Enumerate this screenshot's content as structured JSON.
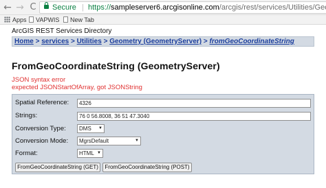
{
  "browser": {
    "nav": {
      "back": "←",
      "forward": "→",
      "reload": "C"
    },
    "secure_label": "Secure",
    "separator": "|",
    "url_scheme": "https://",
    "url_host": "sampleserver6.arcgisonline.com",
    "url_path": "/arcgis/rest/services/Utilities/Geometry/GeometryServer"
  },
  "bookmarks": [
    {
      "label": "Apps"
    },
    {
      "label": "VAPWIS"
    },
    {
      "label": "New Tab"
    }
  ],
  "page": {
    "header": "ArcGIS REST Services Directory",
    "breadcrumb": {
      "items": [
        "Home",
        "services",
        "Utilities",
        "Geometry (GeometryServer)",
        "fromGeoCoordinateString"
      ],
      "separator": ">"
    },
    "title": "FromGeoCoordinateString (GeometryServer)",
    "errors": [
      "JSON syntax error",
      "expected JSONStartOfArray, got JSONString"
    ]
  },
  "form": {
    "spatial_reference": {
      "label": "Spatial Reference:",
      "value": "4326"
    },
    "strings": {
      "label": "Strings:",
      "value": "76 0 56.8008, 36 51 47.3040"
    },
    "conversion_type": {
      "label": "Conversion Type:",
      "value": "DMS"
    },
    "conversion_mode": {
      "label": "Conversion Mode:",
      "value": "MgrsDefault"
    },
    "format": {
      "label": "Format:",
      "value": "HTML"
    },
    "buttons": {
      "get": "FromGeoCoordinateString (GET)",
      "post": "FromGeoCoordinateString (POST)"
    }
  },
  "colors": {
    "secure_green": "#0b8043",
    "link_blue": "#1a3d9c",
    "error_red": "#e03030",
    "panel_bg": "#d3dae3"
  }
}
